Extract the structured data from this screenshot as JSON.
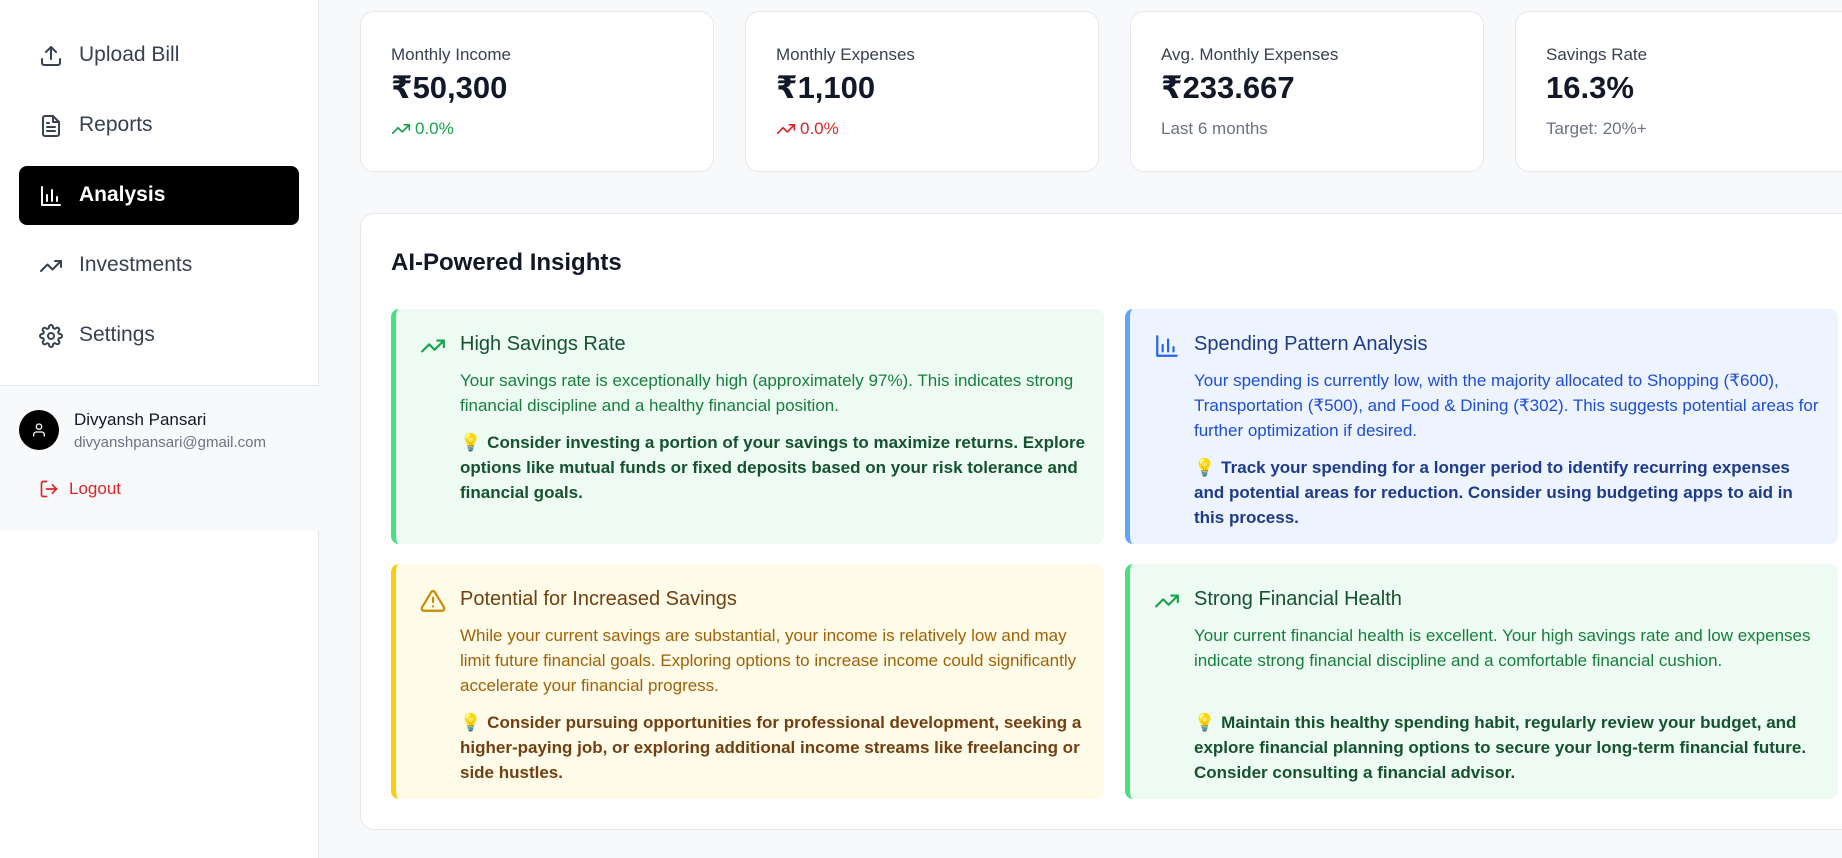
{
  "sidebar": {
    "items": [
      {
        "label": "Upload Bill",
        "icon": "upload-icon"
      },
      {
        "label": "Reports",
        "icon": "document-icon"
      },
      {
        "label": "Analysis",
        "icon": "bar-chart-icon",
        "active": true
      },
      {
        "label": "Investments",
        "icon": "trending-up-icon"
      },
      {
        "label": "Settings",
        "icon": "gear-icon"
      }
    ],
    "user": {
      "name": "Divyansh Pansari",
      "email": "divyanshpansari@gmail.com",
      "logout_label": "Logout"
    }
  },
  "stats": [
    {
      "title": "Monthly Income",
      "value": "₹50,300",
      "sub": "0.0%",
      "trend": "up"
    },
    {
      "title": "Monthly Expenses",
      "value": "₹1,100",
      "sub": "0.0%",
      "trend": "down"
    },
    {
      "title": "Avg. Monthly Expenses",
      "value": "₹233.667",
      "sub": "Last 6 months"
    },
    {
      "title": "Savings Rate",
      "value": "16.3%",
      "sub": "Target: 20%+"
    }
  ],
  "insights": {
    "title": "AI-Powered Insights",
    "cards": [
      {
        "title": "High Savings Rate",
        "icon": "trending-up-icon",
        "desc": "Your savings rate is exceptionally high (approximately 97%). This indicates strong financial discipline and a healthy financial position.",
        "tip_icon": "💡",
        "tip": "Consider investing a portion of your savings to maximize returns. Explore options like mutual funds or fixed deposits based on your risk tolerance and financial goals."
      },
      {
        "title": "Spending Pattern Analysis",
        "icon": "bar-chart-icon",
        "desc": "Your spending is currently low, with the majority allocated to Shopping (₹600), Transportation (₹500), and Food & Dining (₹302). This suggests potential areas for further optimization if desired.",
        "tip_icon": "💡",
        "tip": "Track your spending for a longer period to identify recurring expenses and potential areas for reduction. Consider using budgeting apps to aid in this process."
      },
      {
        "title": "Potential for Increased Savings",
        "icon": "warning-icon",
        "desc": "While your current savings are substantial, your income is relatively low and may limit future financial goals. Exploring options to increase income could significantly accelerate your financial progress.",
        "tip_icon": "💡",
        "tip": "Consider pursuing opportunities for professional development, seeking a higher-paying job, or exploring additional income streams like freelancing or side hustles."
      },
      {
        "title": "Strong Financial Health",
        "icon": "trending-up-icon",
        "desc": "Your current financial health is excellent. Your high savings rate and low expenses indicate strong financial discipline and a comfortable financial cushion.",
        "tip_icon": "💡",
        "tip": "Maintain this healthy spending habit, regularly review your budget, and explore financial planning options to secure your long-term financial future. Consider consulting a financial advisor."
      }
    ]
  },
  "colors": {
    "active_nav": "#000000",
    "income_trend": "#16a34a",
    "expense_trend": "#dc2626",
    "logout": "#dc2626",
    "insight_green": "#4ade80",
    "insight_blue": "#60a5fa",
    "insight_yellow": "#facc15"
  }
}
